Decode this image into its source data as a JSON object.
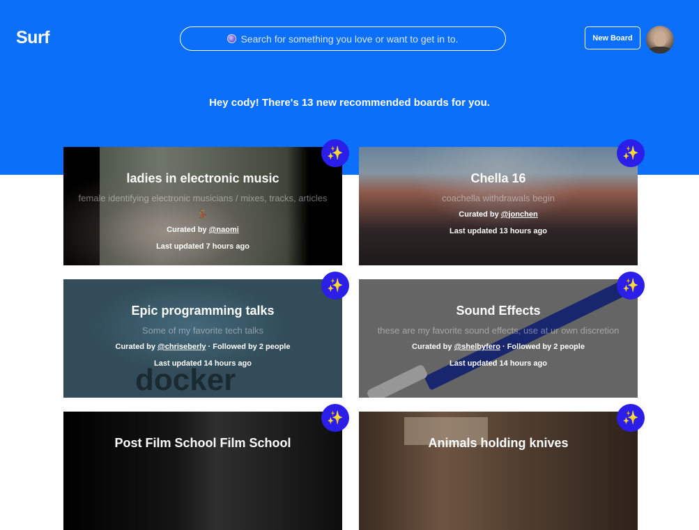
{
  "app": {
    "logo": "Surf"
  },
  "search": {
    "placeholder": "Search for something you love or want to get in to.",
    "icon": "crystal-ball-icon"
  },
  "header": {
    "new_board_label": "New Board"
  },
  "greeting": "Hey cody! There's 13 new recommended boards for you.",
  "cards": [
    {
      "title": "ladies in electronic music",
      "description": "female identifying electronic musicians / mixes, tracks, articles 💃",
      "curated_prefix": "Curated by ",
      "user": "@naomi",
      "followers": "",
      "updated": "Last updated 7 hours ago"
    },
    {
      "title": "Chella 16",
      "description": "coachella withdrawals begin",
      "curated_prefix": "Curated by ",
      "user": "@jonchen",
      "followers": "",
      "updated": "Last updated 13 hours ago"
    },
    {
      "title": "Epic programming talks",
      "description": "Some of my favorite tech talks",
      "curated_prefix": "Curated by ",
      "user": "@chriseberly",
      "followers": " · Followed by 2 people",
      "updated": "Last updated 14 hours ago"
    },
    {
      "title": "Sound Effects",
      "description": "these are my favorite sound effects, use at ur own discretion",
      "curated_prefix": "Curated by ",
      "user": "@shelbyfero",
      "followers": " · Followed by 2 people",
      "updated": "Last updated 14 hours ago"
    },
    {
      "title": "Post Film School Film School",
      "description": "",
      "curated_prefix": "",
      "user": "",
      "followers": "",
      "updated": ""
    },
    {
      "title": "Animals holding knives",
      "description": "",
      "curated_prefix": "",
      "user": "",
      "followers": "",
      "updated": ""
    }
  ],
  "badge_icon": "sparkle-star-icon",
  "colors": {
    "header_bg": "#0b6ff9",
    "badge_bg": "#2a1ee8"
  }
}
